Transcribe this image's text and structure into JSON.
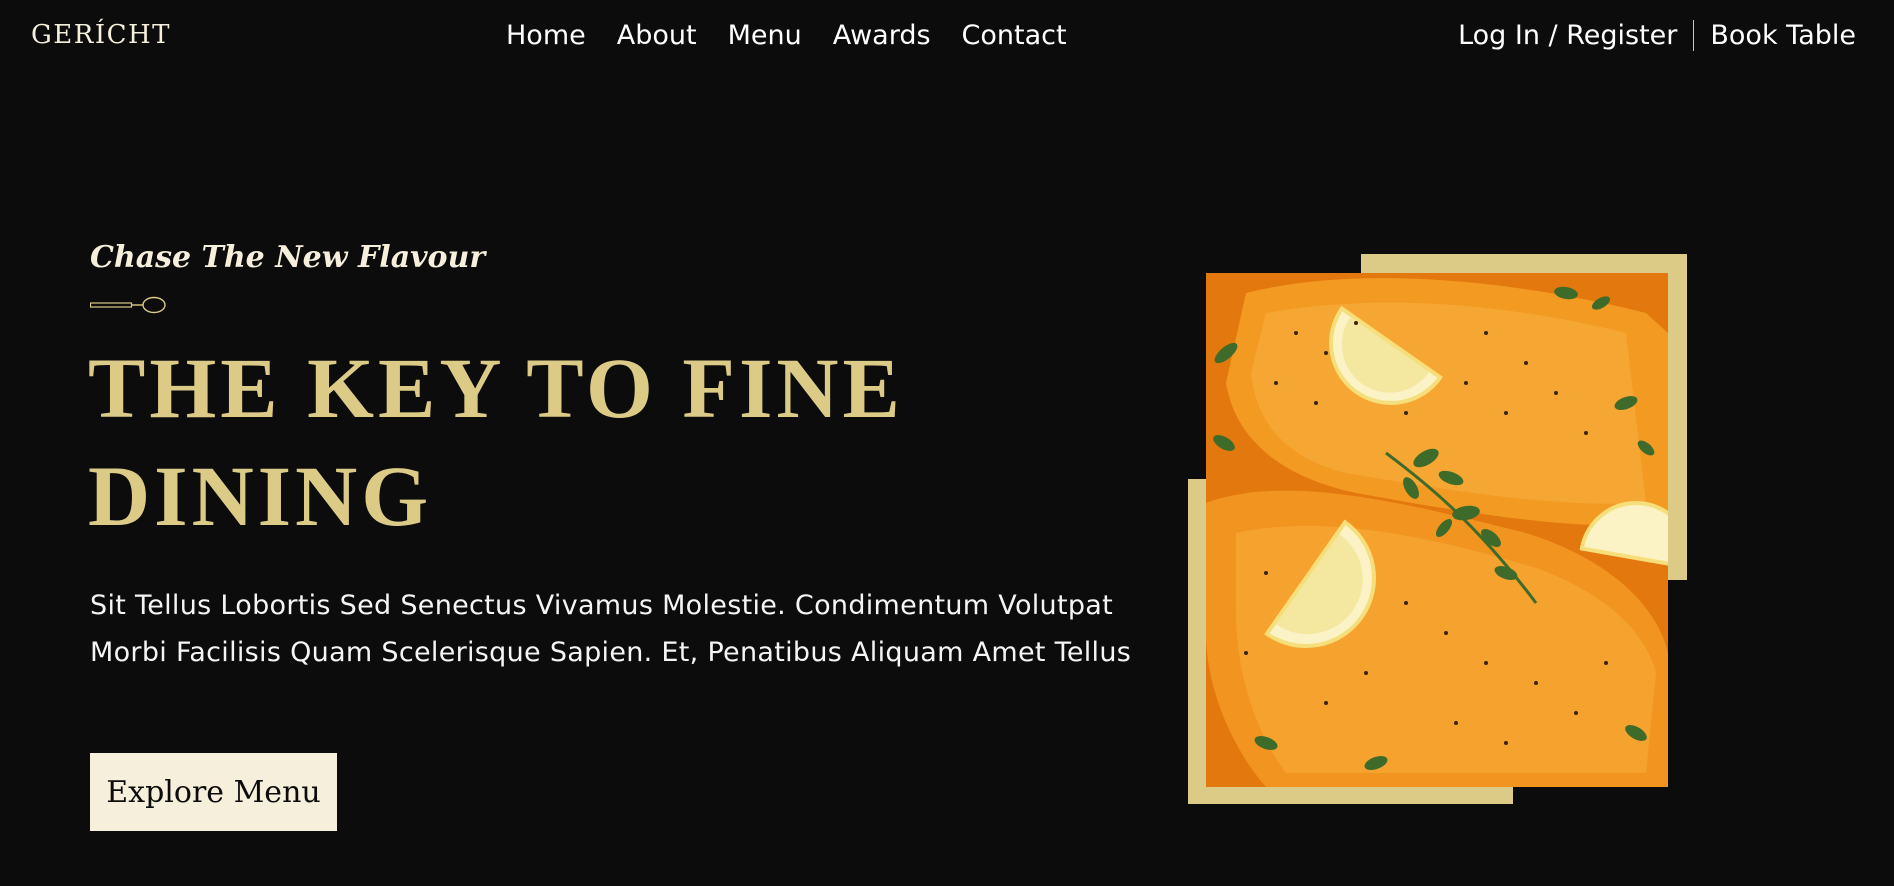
{
  "navbar": {
    "logo": "GERÍCHT",
    "links": [
      "Home",
      "About",
      "Menu",
      "Awards",
      "Contact"
    ],
    "login": "Log In / Register",
    "book_table": "Book Table"
  },
  "hero": {
    "subtitle": "Chase The New Flavour",
    "headline": "THE KEY TO FINE DINING",
    "description": "Sit Tellus Lobortis Sed Senectus Vivamus Molestie. Condimentum Volutpat Morbi Facilisis Quam Scelerisque Sapien. Et, Penatibus Aliquam Amet Tellus",
    "cta_label": "Explore Menu"
  },
  "colors": {
    "background": "#0C0C0C",
    "gold": "#DCCA87",
    "cream": "#F5EFDB",
    "white": "#FFFFFF"
  },
  "icons": {
    "spoon": "spoon-icon"
  }
}
